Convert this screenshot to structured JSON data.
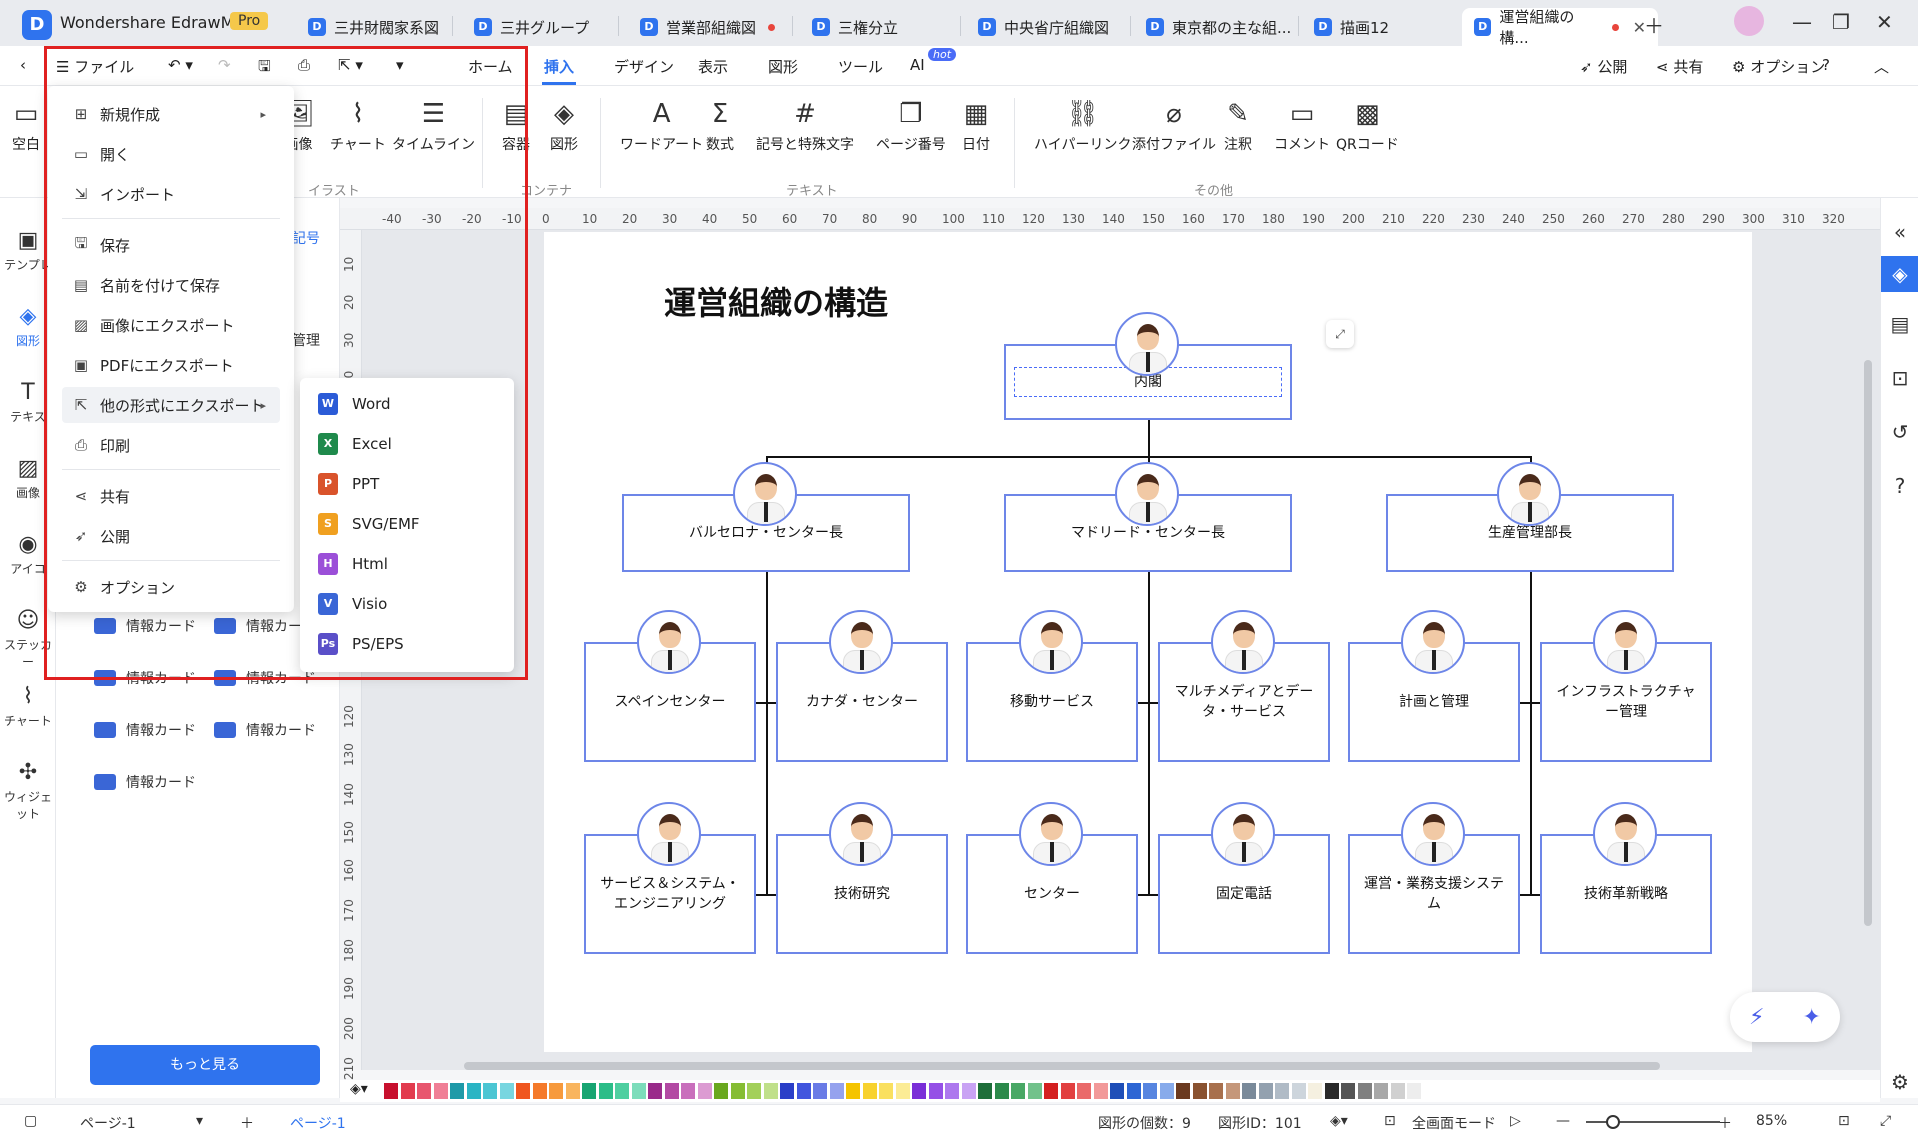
{
  "app": {
    "logo": "D",
    "name": "Wondershare EdrawMax",
    "badge": "Pro"
  },
  "tabs": [
    {
      "label": "三井財閥家系図",
      "dot": false
    },
    {
      "label": "三井グループ",
      "dot": false
    },
    {
      "label": "営業部組織図",
      "dot": true
    },
    {
      "label": "三権分立",
      "dot": false
    },
    {
      "label": "中央省庁組織図",
      "dot": false
    },
    {
      "label": "東京都の主な組...",
      "dot": false
    },
    {
      "label": "描画12",
      "dot": true
    },
    {
      "label": "運営組織の構...",
      "dot": true,
      "active": true
    }
  ],
  "menubar": {
    "file": "ファイル",
    "home": "ホーム",
    "insert": "挿入",
    "design": "デザイン",
    "view": "表示",
    "shape": "図形",
    "tools": "ツール",
    "ai": "AI",
    "ai_badge": "hot",
    "publish": "公開",
    "share": "共有",
    "options": "オプション",
    "help": "?"
  },
  "ribbon": {
    "buttons": [
      {
        "label": "空白",
        "icon": "blank-icon"
      },
      {
        "label": "画像",
        "icon": "image-icon"
      },
      {
        "label": "チャート",
        "icon": "chart-icon"
      },
      {
        "label": "タイムライン",
        "icon": "timeline-icon"
      },
      {
        "label": "容器",
        "icon": "container-icon"
      },
      {
        "label": "図形",
        "icon": "shape-icon"
      },
      {
        "label": "ワードアート",
        "icon": "wordart-icon"
      },
      {
        "label": "数式",
        "icon": "formula-icon"
      },
      {
        "label": "記号と特殊文字",
        "icon": "symbol-icon"
      },
      {
        "label": "ページ番号",
        "icon": "page-number-icon"
      },
      {
        "label": "日付",
        "icon": "date-icon"
      },
      {
        "label": "ハイパーリンク",
        "icon": "hyperlink-icon"
      },
      {
        "label": "添付ファイル",
        "icon": "attachment-icon"
      },
      {
        "label": "注釈",
        "icon": "annotation-icon"
      },
      {
        "label": "コメント",
        "icon": "comment-icon"
      },
      {
        "label": "QRコード",
        "icon": "qr-icon"
      }
    ],
    "groups": [
      "イラスト",
      "コンテナ",
      "テキスト",
      "その他"
    ]
  },
  "rail": [
    {
      "label": "テンプレ",
      "icon": "template-icon"
    },
    {
      "label": "図形",
      "icon": "shapes-icon"
    },
    {
      "label": "テキス",
      "icon": "text-icon"
    },
    {
      "label": "画像",
      "icon": "picture-icon"
    },
    {
      "label": "アイコ",
      "icon": "icon-library-icon"
    },
    {
      "label": "ステッカー",
      "icon": "sticker-icon"
    },
    {
      "label": "チャート",
      "icon": "chart-line-icon"
    },
    {
      "label": "ウィジェット",
      "icon": "widget-icon"
    }
  ],
  "library": {
    "partial_labels": [
      "記号",
      "管理"
    ],
    "cards": [
      "情報カード",
      "情報カード",
      "情報カード",
      "情報カード",
      "情報カード",
      "情報カード",
      "情報カード"
    ],
    "more": "もっと見る"
  },
  "file_menu": {
    "items": [
      {
        "label": "新規作成",
        "icon": "new-icon",
        "arrow": true
      },
      {
        "label": "開く",
        "icon": "open-icon"
      },
      {
        "label": "インポート",
        "icon": "import-icon"
      },
      {
        "label": "保存",
        "icon": "save-icon"
      },
      {
        "label": "名前を付けて保存",
        "icon": "save-as-icon"
      },
      {
        "label": "画像にエクスポート",
        "icon": "export-image-icon"
      },
      {
        "label": "PDFにエクスポート",
        "icon": "export-pdf-icon"
      },
      {
        "label": "他の形式にエクスポート",
        "icon": "export-other-icon",
        "arrow": true
      },
      {
        "label": "印刷",
        "icon": "print-icon"
      },
      {
        "label": "共有",
        "icon": "share-icon"
      },
      {
        "label": "公開",
        "icon": "publish-icon"
      },
      {
        "label": "オプション",
        "icon": "options-icon"
      }
    ]
  },
  "export_submenu": [
    {
      "label": "Word",
      "icon": "word-icon",
      "letter": "W",
      "color": "#2b5bd7"
    },
    {
      "label": "Excel",
      "icon": "excel-icon",
      "letter": "X",
      "color": "#1f8a4c"
    },
    {
      "label": "PPT",
      "icon": "ppt-icon",
      "letter": "P",
      "color": "#d9532b"
    },
    {
      "label": "SVG/EMF",
      "icon": "svg-icon",
      "letter": "S",
      "color": "#f0a020"
    },
    {
      "label": "Html",
      "icon": "html-icon",
      "letter": "H",
      "color": "#9b4fd8"
    },
    {
      "label": "Visio",
      "icon": "visio-icon",
      "letter": "V",
      "color": "#3a66d6"
    },
    {
      "label": "PS/EPS",
      "icon": "ps-icon",
      "letter": "Ps",
      "color": "#5a4fc8"
    }
  ],
  "ruler": {
    "h_ticks": [
      "-40",
      "-30",
      "-20",
      "-10",
      "0",
      "10",
      "20",
      "30",
      "40",
      "50",
      "60",
      "70",
      "80",
      "90",
      "100",
      "110",
      "120",
      "130",
      "140",
      "150",
      "160",
      "170",
      "180",
      "190",
      "200",
      "210",
      "220",
      "230",
      "240",
      "250",
      "260",
      "270",
      "280",
      "290",
      "300",
      "310",
      "320"
    ],
    "v_ticks": [
      "10",
      "20",
      "30",
      "40",
      "120",
      "130",
      "140",
      "150",
      "160",
      "170",
      "180",
      "190",
      "200",
      "210"
    ]
  },
  "diagram": {
    "title": "運営組織の構造",
    "root": "内閣",
    "level1": [
      "バルセロナ・センター長",
      "マドリード・センター長",
      "生産管理部長"
    ],
    "level2_row1": [
      "スペインセンター",
      "カナダ・センター",
      "移動サービス",
      "マルチメディアとデータ・サービス",
      "計画と管理",
      "インフラストラクチャー管理"
    ],
    "level2_row2": [
      "サービス＆システム・エンジニアリング",
      "技術研究",
      "センター",
      "固定電話",
      "運営・業務支援システム",
      "技術革新戦略"
    ]
  },
  "palette": [
    "#c8102e",
    "#e23b4e",
    "#e8566e",
    "#f07f96",
    "#1f9aa8",
    "#2bb5c4",
    "#4cc6d3",
    "#78d6e0",
    "#f0571f",
    "#f57a2a",
    "#f79a3c",
    "#f9b55e",
    "#18a572",
    "#2cbd88",
    "#4fcfa0",
    "#7dddbb",
    "#9a2b8a",
    "#b34aa3",
    "#c96fbc",
    "#dc9bd2",
    "#6aa81f",
    "#86bd33",
    "#a3d05a",
    "#c0e08a",
    "#2b3fc8",
    "#4256de",
    "#6a7be6",
    "#95a2ee",
    "#f5c400",
    "#f8d22e",
    "#fae05f",
    "#fcec95",
    "#7b2fd8",
    "#9550e6",
    "#ad78ee",
    "#c9a3f4",
    "#1f6f3a",
    "#2c8a4b",
    "#49a865",
    "#72c28b",
    "#d42020",
    "#e24040",
    "#ea6a6a",
    "#f29999",
    "#1f4fb8",
    "#2e66d4",
    "#5785e0",
    "#88abeb",
    "#6b3a1f",
    "#8a5230",
    "#a8704d",
    "#c5977a",
    "#7a8a9a",
    "#93a1af",
    "#b0bbc6",
    "#cdd5dc",
    "#f5f0e0",
    "#2a2a2a",
    "#555555",
    "#808080",
    "#a8a8a8",
    "#d0d0d0",
    "#ededed"
  ],
  "status": {
    "page_label": "ページ-1",
    "page_tab": "ページ-1",
    "shape_count": "図形の個数：9",
    "shape_id": "図形ID：101",
    "fullscreen": "全画面モード",
    "zoom": "85%"
  }
}
